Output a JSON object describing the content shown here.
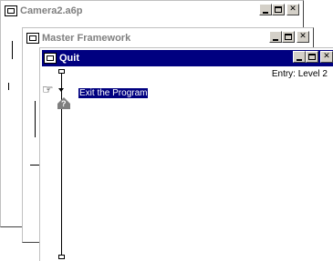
{
  "windows": {
    "camera": {
      "title": "Camera2.a6p"
    },
    "master": {
      "title": "Master Framework"
    },
    "quit": {
      "title": "Quit",
      "entry_label": "Entry: Level 2",
      "flowline_items": [
        {
          "label": "Exit the Program",
          "icon": "quit-icon",
          "glyph": "?"
        }
      ]
    }
  },
  "colors": {
    "active_title": "#000080",
    "inactive_title_text": "#808080",
    "selection": "#000080"
  }
}
